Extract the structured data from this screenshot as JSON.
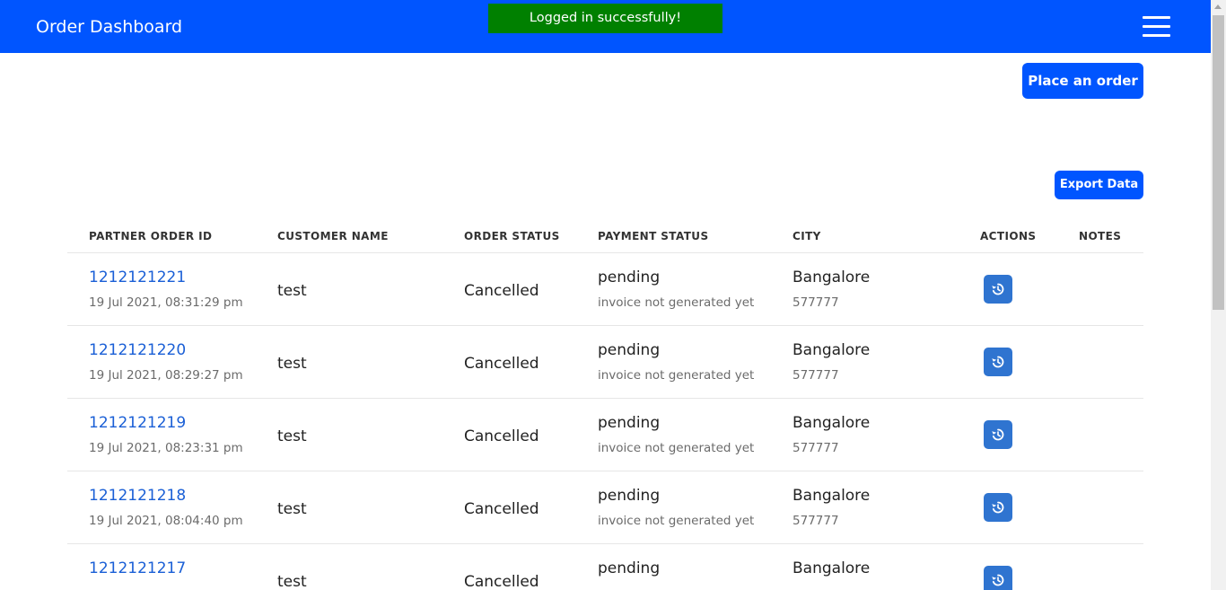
{
  "navbar": {
    "title": "Order Dashboard",
    "menu_icon": "hamburger-menu-icon"
  },
  "toast": {
    "message": "Logged in successfully!",
    "color": "#008000"
  },
  "buttons": {
    "place_order": "Place an order",
    "export_data": "Export Data"
  },
  "colors": {
    "brand": "#0055ff",
    "link": "#1a5fd6",
    "action": "#2f74d0"
  },
  "table": {
    "headers": [
      "PARTNER ORDER ID",
      "CUSTOMER NAME",
      "ORDER STATUS",
      "PAYMENT STATUS",
      "CITY",
      "ACTIONS",
      "NOTES"
    ],
    "rows": [
      {
        "order_id": "1212121221",
        "date": "19 Jul 2021, 08:31:29 pm",
        "customer": "test",
        "status": "Cancelled",
        "payment": "pending",
        "invoice": "invoice not generated yet",
        "city": "Bangalore",
        "pincode": "577777",
        "action_icon": "history-icon"
      },
      {
        "order_id": "1212121220",
        "date": "19 Jul 2021, 08:29:27 pm",
        "customer": "test",
        "status": "Cancelled",
        "payment": "pending",
        "invoice": "invoice not generated yet",
        "city": "Bangalore",
        "pincode": "577777",
        "action_icon": "history-icon"
      },
      {
        "order_id": "1212121219",
        "date": "19 Jul 2021, 08:23:31 pm",
        "customer": "test",
        "status": "Cancelled",
        "payment": "pending",
        "invoice": "invoice not generated yet",
        "city": "Bangalore",
        "pincode": "577777",
        "action_icon": "history-icon"
      },
      {
        "order_id": "1212121218",
        "date": "19 Jul 2021, 08:04:40 pm",
        "customer": "test",
        "status": "Cancelled",
        "payment": "pending",
        "invoice": "invoice not generated yet",
        "city": "Bangalore",
        "pincode": "577777",
        "action_icon": "history-icon"
      },
      {
        "order_id": "1212121217",
        "date": "",
        "customer": "test",
        "status": "Cancelled",
        "payment": "pending",
        "invoice": "",
        "city": "Bangalore",
        "pincode": "",
        "action_icon": "history-icon"
      }
    ]
  }
}
